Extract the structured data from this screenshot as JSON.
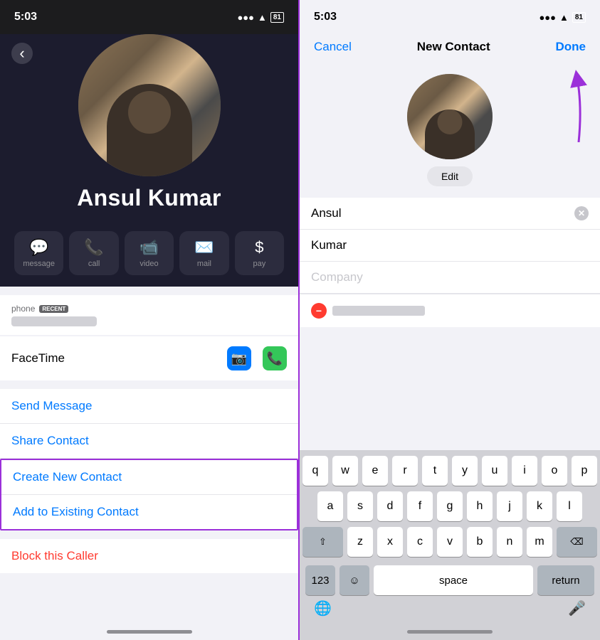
{
  "left": {
    "time": "5:03",
    "signal": "●●●",
    "wifi": "WiFi",
    "battery": "81",
    "contact_name": "Ansul Kumar",
    "phone_label": "phone",
    "recent_badge": "RECENT",
    "facetime_label": "FaceTime",
    "actions": {
      "send_message": "Send Message",
      "share_contact": "Share Contact",
      "create_new_contact": "Create New Contact",
      "add_existing_contact": "Add to Existing Contact",
      "block_caller": "Block this Caller"
    },
    "action_buttons": [
      {
        "label": "message",
        "icon": "💬"
      },
      {
        "label": "call",
        "icon": "📞"
      },
      {
        "label": "video",
        "icon": "📹"
      },
      {
        "label": "mail",
        "icon": "✉️"
      },
      {
        "label": "pay",
        "icon": "$"
      }
    ]
  },
  "right": {
    "time": "5:03",
    "signal": "●●●",
    "wifi": "WiFi",
    "battery": "81",
    "nav": {
      "cancel": "Cancel",
      "title": "New Contact",
      "done": "Done"
    },
    "edit_label": "Edit",
    "fields": {
      "first_name": "Ansul",
      "last_name": "Kumar",
      "company_placeholder": "Company"
    },
    "keyboard": {
      "row1": [
        "q",
        "w",
        "e",
        "r",
        "t",
        "y",
        "u",
        "i",
        "o",
        "p"
      ],
      "row2": [
        "a",
        "s",
        "d",
        "f",
        "g",
        "h",
        "j",
        "k",
        "l"
      ],
      "row3": [
        "z",
        "x",
        "c",
        "v",
        "b",
        "n",
        "m"
      ],
      "space_label": "space",
      "return_label": "return",
      "num_label": "123",
      "delete_icon": "⌫"
    }
  }
}
